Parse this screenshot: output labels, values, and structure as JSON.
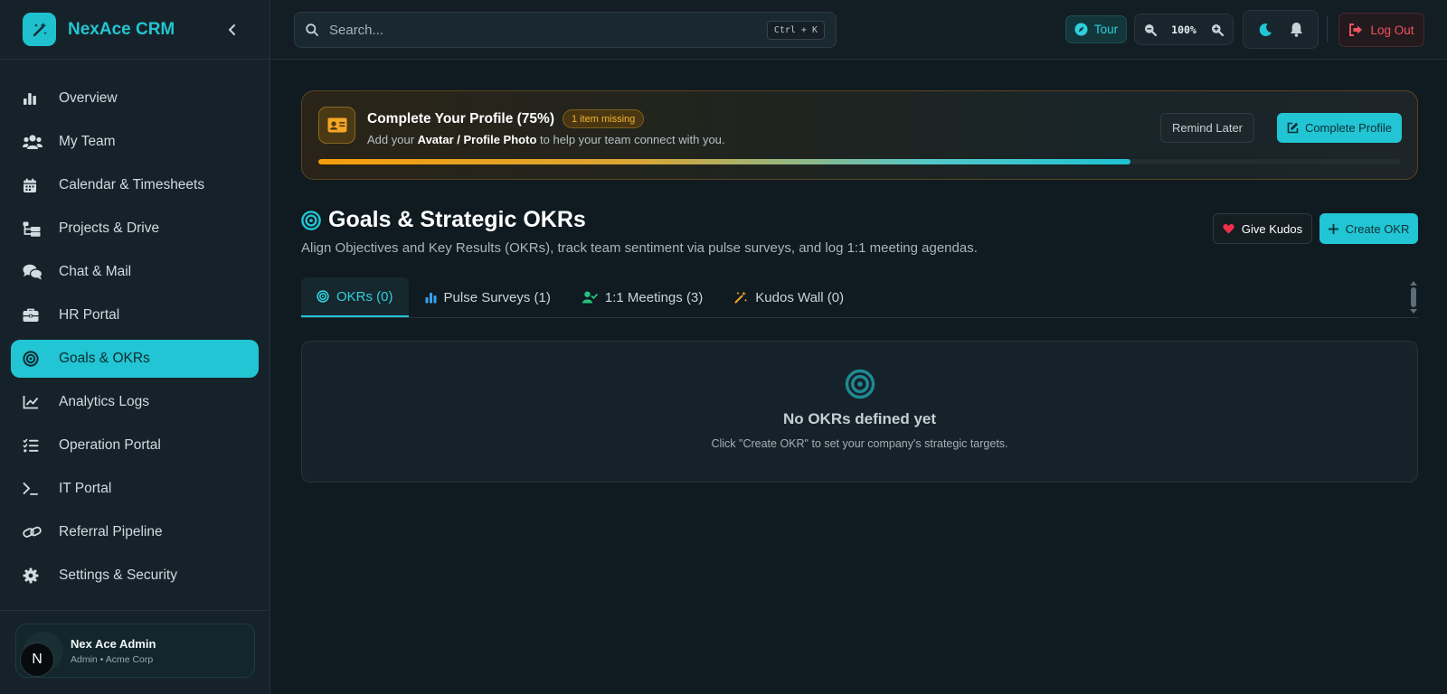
{
  "app": {
    "name": "NexAce CRM",
    "logo_icon": "magic-wand-icon",
    "collapse_icon": "chevron-left-icon"
  },
  "colors": {
    "accent": "#22c5d3",
    "background": "#0f1a21",
    "sidebar": "#162229",
    "warning": "#f59e0b",
    "danger": "#f0545f"
  },
  "sidebar": {
    "items": [
      {
        "label": "Overview",
        "icon": "bar-chart-icon",
        "active": false
      },
      {
        "label": "My Team",
        "icon": "users-icon",
        "active": false
      },
      {
        "label": "Calendar & Timesheets",
        "icon": "calendar-icon",
        "active": false
      },
      {
        "label": "Projects & Drive",
        "icon": "folder-tree-icon",
        "active": false
      },
      {
        "label": "Chat & Mail",
        "icon": "comments-icon",
        "active": false
      },
      {
        "label": "HR Portal",
        "icon": "briefcase-icon",
        "active": false
      },
      {
        "label": "Goals & OKRs",
        "icon": "target-icon",
        "active": true
      },
      {
        "label": "Analytics Logs",
        "icon": "line-chart-icon",
        "active": false
      },
      {
        "label": "Operation Portal",
        "icon": "list-check-icon",
        "active": false
      },
      {
        "label": "IT Portal",
        "icon": "terminal-icon",
        "active": false
      },
      {
        "label": "Referral Pipeline",
        "icon": "link-icon",
        "active": false
      },
      {
        "label": "Settings & Security",
        "icon": "gear-icon",
        "active": false
      }
    ],
    "user": {
      "name": "Nex Ace Admin",
      "role": "Admin • Acme Corp",
      "avatar_letter": "N"
    }
  },
  "topbar": {
    "search": {
      "placeholder": "Search...",
      "value": "",
      "shortcut": "Ctrl + K"
    },
    "tour_label": "Tour",
    "zoom": "100%",
    "logout_label": "Log Out"
  },
  "profile_banner": {
    "title": "Complete Your Profile (75%)",
    "badge": "1 item missing",
    "desc_prefix": "Add your",
    "desc_bold": "Avatar / Profile Photo",
    "desc_suffix": "to help your team connect with you.",
    "progress": 0.75,
    "remind_label": "Remind Later",
    "complete_label": "Complete Profile"
  },
  "page": {
    "title": "Goals & Strategic OKRs",
    "subtitle": "Align Objectives and Key Results (OKRs), track team sentiment via pulse surveys, and log 1:1 meeting agendas.",
    "kudos_label": "Give Kudos",
    "create_label": "Create OKR"
  },
  "tabs": [
    {
      "label": "OKRs (0)",
      "icon": "target-icon",
      "active": true
    },
    {
      "label": "Pulse Surveys (1)",
      "icon": "bar-chart-icon",
      "active": false
    },
    {
      "label": "1:1 Meetings (3)",
      "icon": "user-check-icon",
      "active": false
    },
    {
      "label": "Kudos Wall (0)",
      "icon": "magic-wand-icon",
      "active": false
    }
  ],
  "empty_state": {
    "title": "No OKRs defined yet",
    "subtitle": "Click \"Create OKR\" to set your company's strategic targets."
  }
}
